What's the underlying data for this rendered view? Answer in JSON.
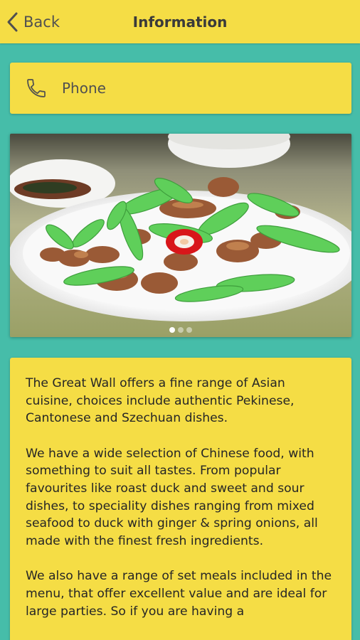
{
  "header": {
    "back_label": "Back",
    "title": "Information"
  },
  "phone": {
    "icon": "phone-icon",
    "label": "Phone"
  },
  "carousel": {
    "image_alt": "Stir-fried pork with bitter melon and red chili",
    "page_count": 3,
    "active_page": 1
  },
  "info": {
    "paragraphs": [
      "The Great Wall offers a fine range of Asian cuisine, choices include authentic Pekinese, Cantonese and Szechuan dishes.",
      "We have a wide selection of Chinese food, with  something to suit all tastes. From popular favourites like roast duck and sweet and sour dishes, to speciality dishes ranging from mixed seafood  to duck with ginger & spring onions, all made with the finest fresh ingredients.",
      "We also have a range of set meals included in the menu, that offer excellent value and are ideal for large parties.  So if you are having a"
    ]
  },
  "colors": {
    "background": "#46bda9",
    "card": "#f5dd45",
    "text": "#262626"
  }
}
